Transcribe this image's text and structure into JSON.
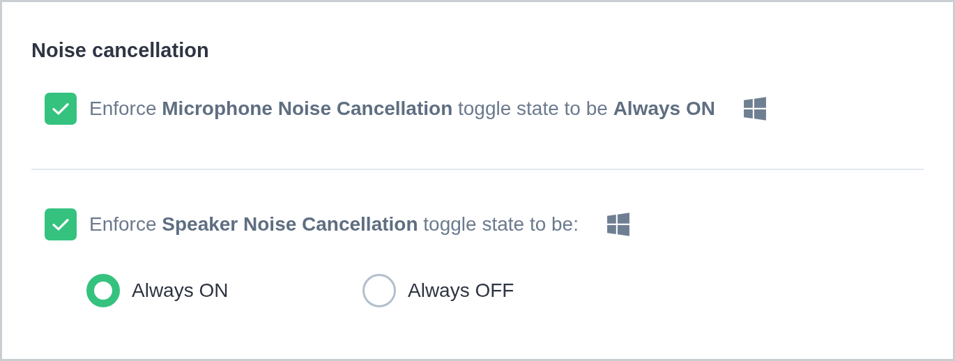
{
  "section": {
    "title": "Noise cancellation"
  },
  "settings": [
    {
      "checked": true,
      "label": "Enforce **Microphone Noise Cancellation** toggle state to be **Always ON**"
    },
    {
      "checked": true,
      "label": "Enforce **Speaker Noise Cancellation** toggle state to be:",
      "choices": [
        {
          "label": "Always ON",
          "selected": true
        },
        {
          "label": "Always OFF",
          "selected": false
        }
      ]
    }
  ]
}
